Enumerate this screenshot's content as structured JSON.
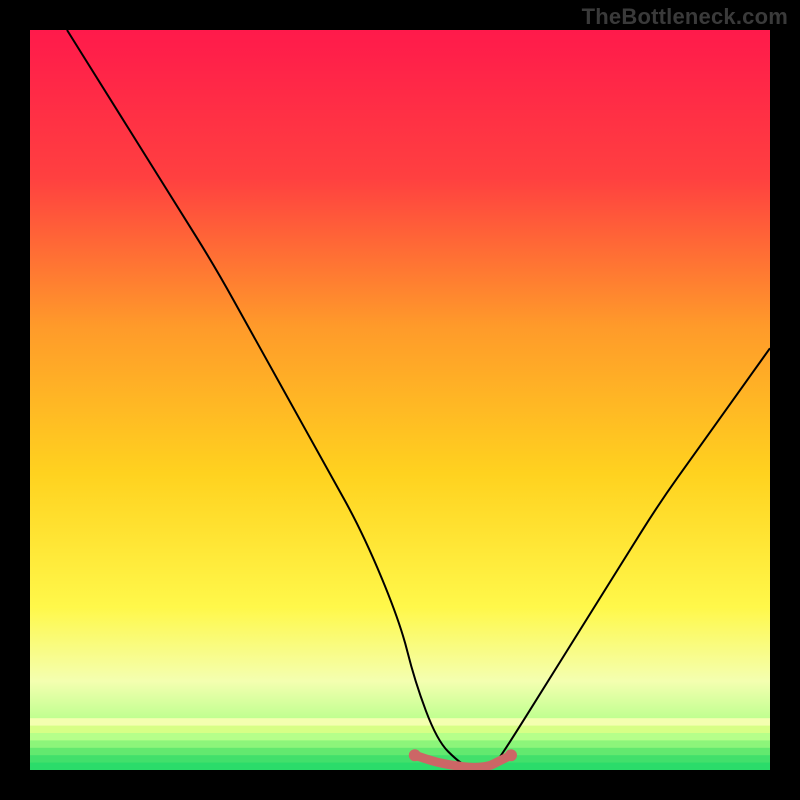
{
  "watermark": "TheBottleneck.com",
  "chart_data": {
    "type": "line",
    "title": "",
    "xlabel": "",
    "ylabel": "",
    "xlim": [
      0,
      100
    ],
    "ylim": [
      0,
      100
    ],
    "series": [
      {
        "name": "curve",
        "x": [
          5,
          10,
          15,
          20,
          25,
          30,
          35,
          40,
          45,
          50,
          52,
          55,
          58,
          60,
          62,
          63,
          65,
          70,
          75,
          80,
          85,
          90,
          95,
          100
        ],
        "y": [
          100,
          92,
          84,
          76,
          68,
          59,
          50,
          41,
          32,
          20,
          12,
          4,
          1,
          0,
          0,
          1,
          4,
          12,
          20,
          28,
          36,
          43,
          50,
          57
        ]
      },
      {
        "name": "highlight-flat",
        "x": [
          52,
          55,
          58,
          60,
          62,
          63,
          65
        ],
        "y": [
          2,
          1,
          0.5,
          0.3,
          0.5,
          1,
          2
        ]
      }
    ],
    "gradient_bands": [
      {
        "stop": 0.0,
        "color": "#ff1a4b"
      },
      {
        "stop": 0.2,
        "color": "#ff4040"
      },
      {
        "stop": 0.4,
        "color": "#ff9a2a"
      },
      {
        "stop": 0.6,
        "color": "#ffd21f"
      },
      {
        "stop": 0.78,
        "color": "#fff84a"
      },
      {
        "stop": 0.88,
        "color": "#f4ffb0"
      },
      {
        "stop": 0.94,
        "color": "#b6ff8a"
      },
      {
        "stop": 1.0,
        "color": "#2bdc6a"
      }
    ],
    "green_stripes": {
      "y_start": 93,
      "count": 7,
      "colors": [
        "#f4ffb0",
        "#d7ff86",
        "#b6ff8a",
        "#8cf57a",
        "#63e96f",
        "#42e06b",
        "#2bdc6a"
      ]
    },
    "highlight_color": "#cc6666"
  }
}
